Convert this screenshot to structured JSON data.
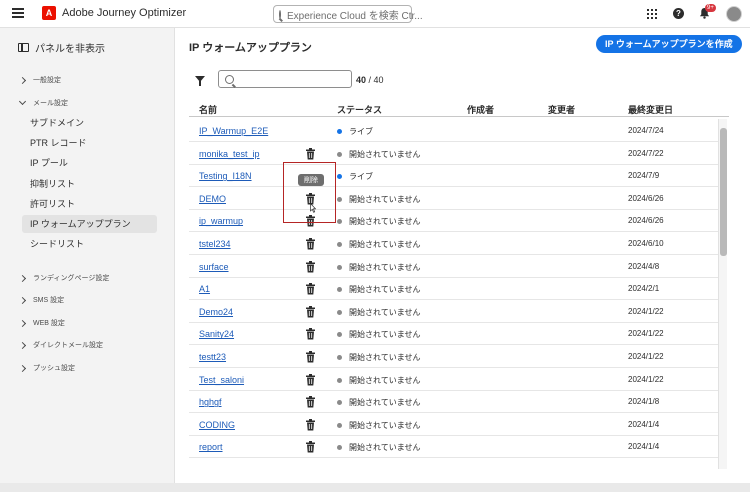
{
  "app": {
    "name": "Adobe Journey Optimizer",
    "search_placeholder": "Experience Cloud を検索 Ctr...",
    "notification_count": "9+"
  },
  "sidebar": {
    "hide_panel_label": "パネルを非表示",
    "groups": [
      {
        "label": "一般設定",
        "expanded": false
      },
      {
        "label": "メール設定",
        "expanded": true
      },
      {
        "label": "ランディングページ設定",
        "expanded": false
      },
      {
        "label": "SMS 設定",
        "expanded": false
      },
      {
        "label": "WEB 設定",
        "expanded": false
      },
      {
        "label": "ダイレクトメール設定",
        "expanded": false
      },
      {
        "label": "プッシュ設定",
        "expanded": false
      }
    ],
    "email_items": [
      {
        "label": "サブドメイン",
        "active": false
      },
      {
        "label": "PTR レコード",
        "active": false
      },
      {
        "label": "IP プール",
        "active": false
      },
      {
        "label": "抑制リスト",
        "active": false
      },
      {
        "label": "許可リスト",
        "active": false
      },
      {
        "label": "IP ウォームアッププラン",
        "active": true
      },
      {
        "label": "シードリスト",
        "active": false
      }
    ]
  },
  "main": {
    "title": "IP ウォームアッププラン",
    "create_button": "IP ウォームアッププランを作成",
    "search_value": "",
    "count_shown": "40",
    "count_total": "/ 40",
    "columns": {
      "name": "名前",
      "status": "ステータス",
      "creator": "作成者",
      "modifier": "変更者",
      "last_modified": "最終変更日"
    },
    "tooltip": "削除",
    "rows": [
      {
        "name": "IP_Warmup_E2E",
        "status": "ライブ",
        "live": true,
        "deletable": false,
        "date": "2024/7/24"
      },
      {
        "name": "monika_test_ip",
        "status": "開始されていません",
        "live": false,
        "deletable": true,
        "date": "2024/7/22"
      },
      {
        "name": "Testing_I18N",
        "status": "ライブ",
        "live": true,
        "deletable": false,
        "date": "2024/7/9"
      },
      {
        "name": "DEMO",
        "status": "開始されていません",
        "live": false,
        "deletable": true,
        "date": "2024/6/26"
      },
      {
        "name": "ip_warmup",
        "status": "開始されていません",
        "live": false,
        "deletable": true,
        "date": "2024/6/26"
      },
      {
        "name": "tstel234",
        "status": "開始されていません",
        "live": false,
        "deletable": true,
        "date": "2024/6/10"
      },
      {
        "name": "surface",
        "status": "開始されていません",
        "live": false,
        "deletable": true,
        "date": "2024/4/8"
      },
      {
        "name": "A1",
        "status": "開始されていません",
        "live": false,
        "deletable": true,
        "date": "2024/2/1"
      },
      {
        "name": "Demo24",
        "status": "開始されていません",
        "live": false,
        "deletable": true,
        "date": "2024/1/22"
      },
      {
        "name": "Sanity24",
        "status": "開始されていません",
        "live": false,
        "deletable": true,
        "date": "2024/1/22"
      },
      {
        "name": "testt23",
        "status": "開始されていません",
        "live": false,
        "deletable": true,
        "date": "2024/1/22"
      },
      {
        "name": "Test_saloni",
        "status": "開始されていません",
        "live": false,
        "deletable": true,
        "date": "2024/1/22"
      },
      {
        "name": "hghgf",
        "status": "開始されていません",
        "live": false,
        "deletable": true,
        "date": "2024/1/8"
      },
      {
        "name": "CODING",
        "status": "開始されていません",
        "live": false,
        "deletable": true,
        "date": "2024/1/4"
      },
      {
        "name": "report",
        "status": "開始されていません",
        "live": false,
        "deletable": true,
        "date": "2024/1/4"
      }
    ]
  },
  "colors": {
    "accent": "#1473e6",
    "link": "#1d5bb8",
    "live_dot": "#1473e6",
    "idle_dot": "#8a8a8a",
    "highlight": "#b52525"
  }
}
